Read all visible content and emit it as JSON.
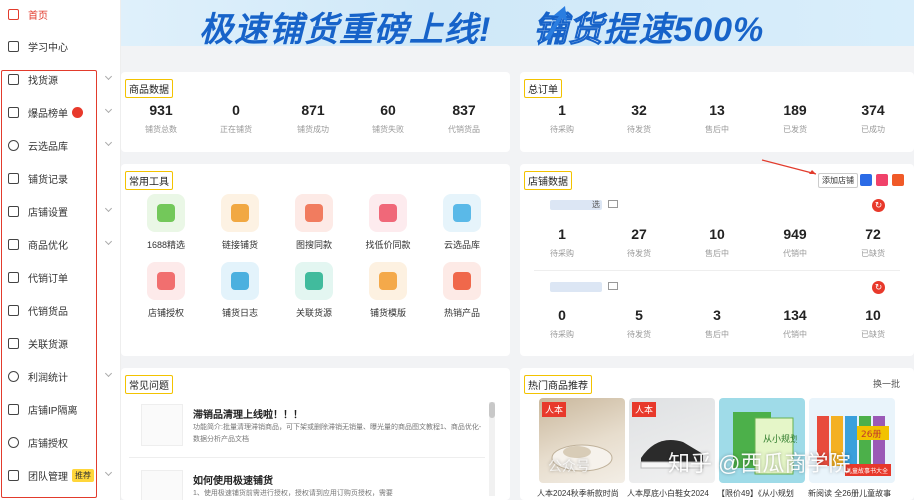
{
  "sidebar": {
    "items": [
      {
        "label": "首页",
        "icon": "home-icon",
        "active": true
      },
      {
        "label": "学习中心",
        "icon": "book-icon"
      },
      {
        "label": "找货源",
        "icon": "box-icon"
      },
      {
        "label": "爆品榜单",
        "icon": "chart-bar-icon"
      },
      {
        "label": "云选品库",
        "icon": "cloud-icon"
      },
      {
        "label": "铺货记录",
        "icon": "record-icon"
      },
      {
        "label": "店铺设置",
        "icon": "store-icon"
      },
      {
        "label": "商品优化",
        "icon": "shopping-bag-icon"
      },
      {
        "label": "代销订单",
        "icon": "order-icon"
      },
      {
        "label": "代销货品",
        "icon": "goods-icon"
      },
      {
        "label": "关联货源",
        "icon": "link-icon"
      },
      {
        "label": "利润统计",
        "icon": "clock-icon"
      },
      {
        "label": "店铺IP隔离",
        "icon": "ip-icon"
      },
      {
        "label": "店铺授权",
        "icon": "shield-icon"
      },
      {
        "label": "团队管理",
        "icon": "team-icon"
      }
    ],
    "team_tag": "推荐"
  },
  "banner": {
    "text_part1": "极速铺货重磅上线!",
    "text_part2": "铺货",
    "text_part3": "提速500%"
  },
  "goods_data": {
    "title": "商品数据",
    "stats": [
      {
        "value": "931",
        "label": "铺货总数"
      },
      {
        "value": "0",
        "label": "正在铺货"
      },
      {
        "value": "871",
        "label": "铺货成功"
      },
      {
        "value": "60",
        "label": "铺货失败"
      },
      {
        "value": "837",
        "label": "代销货品"
      }
    ]
  },
  "total_orders": {
    "title": "总订单",
    "stats": [
      {
        "value": "1",
        "label": "待采购"
      },
      {
        "value": "32",
        "label": "待发货"
      },
      {
        "value": "13",
        "label": "售后中"
      },
      {
        "value": "189",
        "label": "已发货"
      },
      {
        "value": "374",
        "label": "已成功"
      }
    ]
  },
  "tools": {
    "title": "常用工具",
    "items": [
      {
        "label": "1688精选",
        "icon": "ali-1688-icon",
        "bg": "#eaf7e6",
        "fg": "#66c24a"
      },
      {
        "label": "链接铺货",
        "icon": "link-icon",
        "bg": "#fdf2e3",
        "fg": "#f0a030"
      },
      {
        "label": "图搜同款",
        "icon": "image-search-icon",
        "bg": "#fdeae6",
        "fg": "#f07050"
      },
      {
        "label": "找低价同款",
        "icon": "low-price-icon",
        "bg": "#fdebee",
        "fg": "#ee5a6c"
      },
      {
        "label": "云选品库",
        "icon": "cloud-icon",
        "bg": "#e6f4fb",
        "fg": "#4ab3e6"
      },
      {
        "label": "店铺授权",
        "icon": "store-auth-icon",
        "bg": "#fdeaea",
        "fg": "#ef6262"
      },
      {
        "label": "铺货日志",
        "icon": "log-icon",
        "bg": "#e3f3fb",
        "fg": "#3aa8dc"
      },
      {
        "label": "关联货源",
        "icon": "relate-icon",
        "bg": "#e3f6f1",
        "fg": "#2fb594"
      },
      {
        "label": "铺货模版",
        "icon": "template-icon",
        "bg": "#fdf1e1",
        "fg": "#f3a13a"
      },
      {
        "label": "热销产品",
        "icon": "fire-icon",
        "bg": "#fdeae6",
        "fg": "#ee5a3a"
      }
    ]
  },
  "shop_data": {
    "title": "店铺数据",
    "add_shop": "添加店铺",
    "shops": [
      {
        "name_suffix": "选",
        "stats": [
          {
            "value": "1",
            "label": "待采购"
          },
          {
            "value": "27",
            "label": "待发货"
          },
          {
            "value": "10",
            "label": "售后中"
          },
          {
            "value": "949",
            "label": "代销中"
          },
          {
            "value": "72",
            "label": "已缺货"
          }
        ]
      },
      {
        "name_suffix": "",
        "stats": [
          {
            "value": "0",
            "label": "待采购"
          },
          {
            "value": "5",
            "label": "待发货"
          },
          {
            "value": "3",
            "label": "售后中"
          },
          {
            "value": "134",
            "label": "代销中"
          },
          {
            "value": "10",
            "label": "已缺货"
          }
        ]
      }
    ]
  },
  "faq": {
    "title": "常见问题",
    "items": [
      {
        "title": "滞销品清理上线啦！！！",
        "desc": "功能简介:批量清理滞销商品，可下架或删除滞销无销量、曝光量的商品图文教程1、商品优化-数据分析产品文档"
      },
      {
        "title": "如何使用极速铺货",
        "desc": "1、使用极速铺货前需进行授权，授权请到应用订购页授权，需要"
      }
    ]
  },
  "hot": {
    "title": "热门商品推荐",
    "refresh": "换一批",
    "items": [
      {
        "caption": "人本2024秋季新款时尚",
        "tag": "人本"
      },
      {
        "caption": "人本厚底小白鞋女2024",
        "tag": "人本"
      },
      {
        "caption": "【限价49】《从小规划",
        "tag": ""
      },
      {
        "caption": "新阅读 全26册儿童故事",
        "tag": ""
      }
    ],
    "book_overlay1": "从小规划",
    "book_overlay2": "26册",
    "book_overlay3": "儿童故事书大全"
  },
  "watermark": {
    "text": "知乎 @西瓜商学院",
    "ghost": "公众号"
  }
}
